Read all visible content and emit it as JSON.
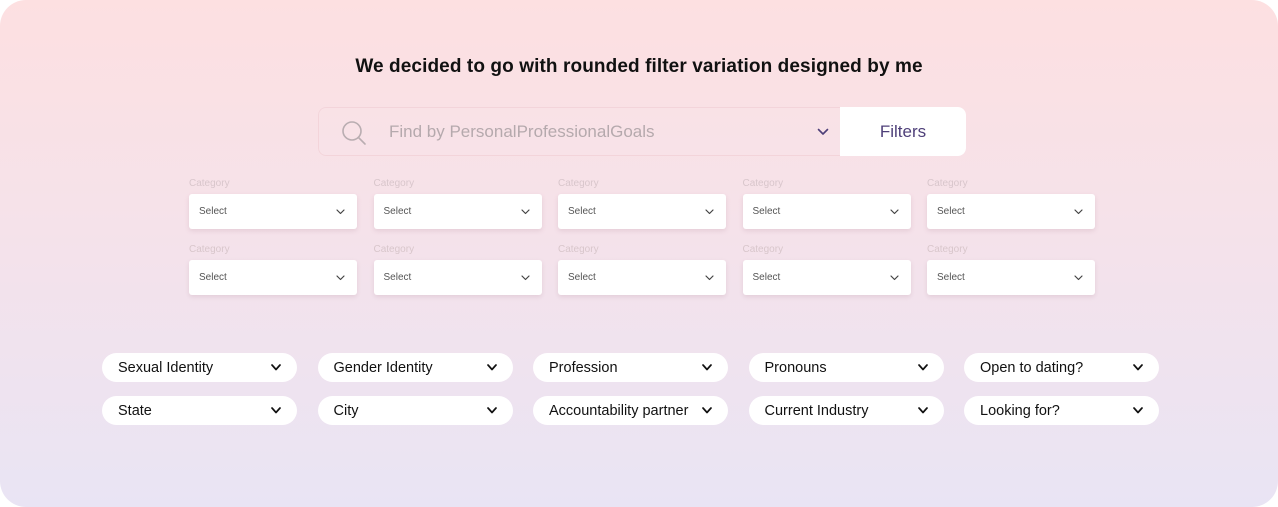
{
  "headline": "We decided to go with rounded filter variation designed by me",
  "search": {
    "placeholder": "Find by PersonalProfessionalGoals",
    "filters_label": "Filters",
    "icon": "search-icon"
  },
  "categories": [
    {
      "label": "Category",
      "value": "Select"
    },
    {
      "label": "Category",
      "value": "Select"
    },
    {
      "label": "Category",
      "value": "Select"
    },
    {
      "label": "Category",
      "value": "Select"
    },
    {
      "label": "Category",
      "value": "Select"
    },
    {
      "label": "Category",
      "value": "Select"
    },
    {
      "label": "Category",
      "value": "Select"
    },
    {
      "label": "Category",
      "value": "Select"
    },
    {
      "label": "Category",
      "value": "Select"
    },
    {
      "label": "Category",
      "value": "Select"
    }
  ],
  "pill_filters": [
    {
      "label": "Sexual Identity"
    },
    {
      "label": "Gender Identity"
    },
    {
      "label": "Profession"
    },
    {
      "label": "Pronouns"
    },
    {
      "label": "Open to dating?"
    },
    {
      "label": "State"
    },
    {
      "label": "City"
    },
    {
      "label": "Accountability partner"
    },
    {
      "label": "Current Industry"
    },
    {
      "label": "Looking for?"
    }
  ],
  "colors": {
    "accent": "#4e3f79",
    "background_top": "#fde0e1",
    "background_bottom": "#e9e4f4"
  }
}
